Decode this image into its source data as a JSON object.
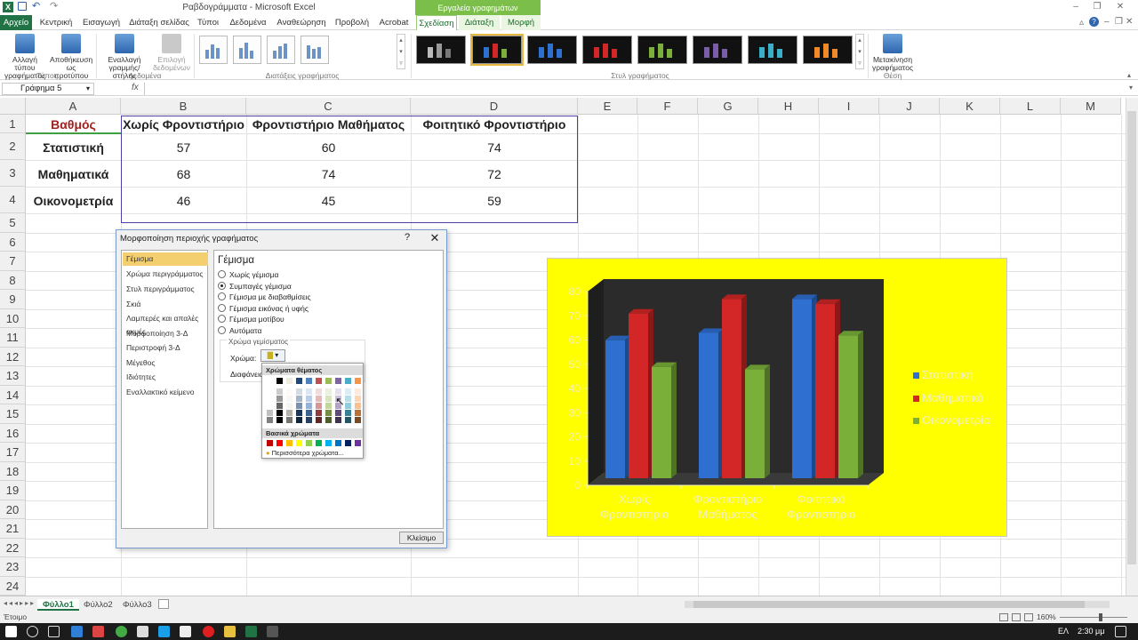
{
  "window": {
    "title": "Ραβδογράμματα - Microsoft Excel",
    "context_group": "Εργαλεία γραφημάτων"
  },
  "tabs": [
    {
      "label": "Αρχείο"
    },
    {
      "label": "Κεντρική"
    },
    {
      "label": "Εισαγωγή"
    },
    {
      "label": "Διάταξη σελίδας"
    },
    {
      "label": "Τύποι"
    },
    {
      "label": "Δεδομένα"
    },
    {
      "label": "Αναθεώρηση"
    },
    {
      "label": "Προβολή"
    },
    {
      "label": "Acrobat"
    },
    {
      "label": "Σχεδίαση"
    },
    {
      "label": "Διάταξη"
    },
    {
      "label": "Μορφή"
    }
  ],
  "ribbon": {
    "change_type": "Αλλαγή τύπου γραφήματος",
    "save_template": "Αποθήκευση ως προτύπου",
    "group_type": "Τύπος",
    "switch_rowcol": "Εναλλαγή γραμμής/στήλης",
    "select_data": "Επιλογή δεδομένων",
    "group_data": "Δεδομένα",
    "group_layouts": "Διατάξεις γραφήματος",
    "group_styles": "Στυλ γραφήματος",
    "move_chart": "Μετακίνηση γραφήματος",
    "group_location": "Θέση"
  },
  "formula": {
    "name_box": "Γράφημα 5",
    "fx": "fx"
  },
  "columns": [
    "A",
    "B",
    "C",
    "D",
    "E",
    "F",
    "G",
    "H",
    "I",
    "J",
    "K",
    "L",
    "M"
  ],
  "rows": [
    "1",
    "2",
    "3",
    "4",
    "5",
    "6",
    "7",
    "8",
    "9",
    "10",
    "11",
    "12",
    "13",
    "14",
    "15",
    "16",
    "17",
    "18",
    "19",
    "20",
    "21",
    "22",
    "23",
    "24"
  ],
  "table": {
    "header": [
      "Βαθμός",
      "Χωρίς Φροντιστήριο",
      "Φροντιστήριο Μαθήματος",
      "Φοιτητικό Φροντιστήριο"
    ],
    "body": [
      [
        "Στατιστική",
        "57",
        "60",
        "74"
      ],
      [
        "Μαθηματικά",
        "68",
        "74",
        "72"
      ],
      [
        "Οικονομετρία",
        "46",
        "45",
        "59"
      ]
    ]
  },
  "dialog": {
    "title": "Μορφοποίηση περιοχής γραφήματος",
    "help": "?",
    "close_x": "✕",
    "nav": [
      "Γέμισμα",
      "Χρώμα περιγράμματος",
      "Στυλ περιγράμματος",
      "Σκιά",
      "Λαμπερές και απαλές ακμές",
      "Μορφοποίηση 3-Δ",
      "Περιστροφή 3-Δ",
      "Μέγεθος",
      "Ιδιότητες",
      "Εναλλακτικό κείμενο"
    ],
    "panel_title": "Γέμισμα",
    "options": [
      "Χωρίς γέμισμα",
      "Συμπαγές γέμισμα",
      "Γέμισμα με διαβαθμίσεις",
      "Γέμισμα εικόνας ή υφής",
      "Γέμισμα μοτίβου",
      "Αυτόματα"
    ],
    "fill_color_group": "Χρώμα γεμίσματος",
    "color_label": "Χρώμα:",
    "transparency_label": "Διαφάνεια",
    "close_button": "Κλείσιμο"
  },
  "palette": {
    "theme_title": "Χρώματα θέματος",
    "standard_title": "Βασικά χρώματα",
    "more": "Περισσότερα χρώματα...",
    "theme_colors": [
      "#ffffff",
      "#000000",
      "#eeece1",
      "#1f497d",
      "#4f81bd",
      "#c0504d",
      "#9bbb59",
      "#8064a2",
      "#4bacc6",
      "#f79646"
    ],
    "standard_colors": [
      "#c00000",
      "#ff0000",
      "#ffc000",
      "#ffff00",
      "#92d050",
      "#00b050",
      "#00b0f0",
      "#0070c0",
      "#002060",
      "#7030a0"
    ]
  },
  "sheets": [
    "Φύλλο1",
    "Φύλλο2",
    "Φύλλο3"
  ],
  "status": {
    "ready": "Έτοιμο",
    "zoom": "160%"
  },
  "taskbar": {
    "lang": "ΕΛ",
    "time": "2:30 μμ"
  },
  "colors": {
    "chart_bg": "#ffff00",
    "plot_bg": "#2b2b2b",
    "accent": "#217346"
  },
  "chart_data": {
    "type": "bar",
    "categories": [
      "Χωρίς Φροντιστήριο",
      "Φροντιστήριο Μαθήματος",
      "Φοιτητικό Φροντιστήριο"
    ],
    "series": [
      {
        "name": "Στατιστική",
        "values": [
          57,
          60,
          74
        ],
        "color": "#2e6fd0"
      },
      {
        "name": "Μαθηματικά",
        "values": [
          68,
          74,
          72
        ],
        "color": "#d32626"
      },
      {
        "name": "Οικονομετρία",
        "values": [
          46,
          45,
          59
        ],
        "color": "#7ab03a"
      }
    ],
    "yticks": [
      "0",
      "10",
      "20",
      "30",
      "40",
      "50",
      "60",
      "70",
      "80"
    ],
    "ylim": [
      0,
      80
    ],
    "legend": "right"
  }
}
